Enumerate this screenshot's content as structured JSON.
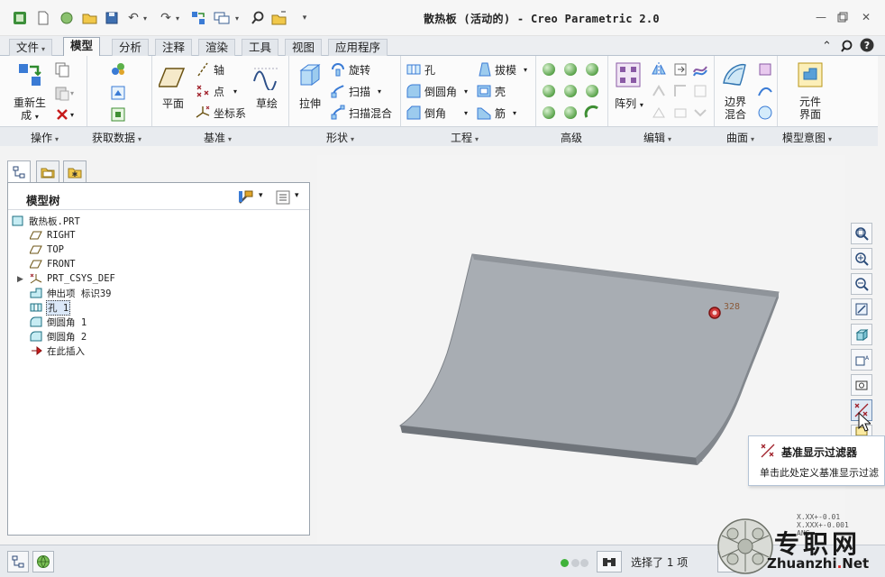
{
  "window": {
    "title": "散热板 (活动的) - Creo Parametric 2.0"
  },
  "quick_access": {
    "icons": [
      "app-logo-icon",
      "new-icon",
      "open-sphere-icon",
      "open-folder-icon",
      "save-icon",
      "undo-icon",
      "redo-icon",
      "regenerate-icon",
      "windows-icon",
      "find-icon",
      "close-window-icon",
      "customize-icon"
    ]
  },
  "tabs": [
    {
      "label": "文件",
      "has_caret": true
    },
    {
      "label": "模型",
      "active": true
    },
    {
      "label": "分析"
    },
    {
      "label": "注释"
    },
    {
      "label": "渲染"
    },
    {
      "label": "工具"
    },
    {
      "label": "视图"
    },
    {
      "label": "应用程序"
    }
  ],
  "ribbon": {
    "operations": {
      "regenerate_label_1": "重新生",
      "regenerate_label_2": "成",
      "group_label": "操作"
    },
    "get_data": {
      "group_label": "获取数据"
    },
    "datum": {
      "plane_label": "平面",
      "axis_label": "轴",
      "point_label": "点",
      "csys_label": "坐标系",
      "sketch_label": "草绘",
      "group_label": "基准"
    },
    "shapes": {
      "extrude_label": "拉伸",
      "revolve_label": "旋转",
      "sweep_label": "扫描",
      "swept_blend_label": "扫描混合",
      "group_label": "形状"
    },
    "engineering": {
      "hole_label": "孔",
      "round_label": "倒圆角",
      "chamfer_label": "倒角",
      "draft_label": "拔模",
      "shell_label": "壳",
      "rib_label": "筋",
      "group_label": "工程"
    },
    "advanced": {
      "group_label": "高级"
    },
    "editing": {
      "pattern_label": "阵列",
      "group_label": "编辑"
    },
    "surfaces": {
      "boundary_blend_label_1": "边界",
      "boundary_blend_label_2": "混合",
      "group_label": "曲面"
    },
    "model_intent": {
      "component_interface_label_1": "元件",
      "component_interface_label_2": "界面",
      "group_label": "模型意图"
    }
  },
  "model_tree": {
    "title": "模型树",
    "nodes": [
      {
        "label": "散热板.PRT",
        "icon": "part-icon"
      },
      {
        "label": "RIGHT",
        "icon": "datum-plane-icon"
      },
      {
        "label": "TOP",
        "icon": "datum-plane-icon"
      },
      {
        "label": "FRONT",
        "icon": "datum-plane-icon"
      },
      {
        "label": "PRT_CSYS_DEF",
        "icon": "csys-icon"
      },
      {
        "label": "伸出项 标识39",
        "icon": "protrusion-icon",
        "expandable": true
      },
      {
        "label": "孔 1",
        "icon": "hole-icon",
        "selected": true
      },
      {
        "label": "倒圆角 1",
        "icon": "round-icon"
      },
      {
        "label": "倒圆角 2",
        "icon": "round-icon"
      },
      {
        "label": "在此插入",
        "icon": "insert-here-icon"
      }
    ]
  },
  "viewport": {
    "hole_tag": "328"
  },
  "tooltip": {
    "title": "基准显示过滤器",
    "description": "单击此处定义基准显示过滤"
  },
  "status": {
    "selection_text": "选择了 1 项",
    "dim_lines": [
      "X.XX+-0.01",
      "X.XXX+-0.001",
      "ANG."
    ]
  },
  "watermark": {
    "cn_text": "专职网",
    "en_prefix": "Zhuanzhi",
    "en_dot": ".",
    "en_suffix": "Net"
  },
  "colors": {
    "accent_green": "#4aa644",
    "plate_top": "#a7acb2",
    "plate_edge": "#6f747a",
    "selection_blue": "#dbe8f8"
  }
}
